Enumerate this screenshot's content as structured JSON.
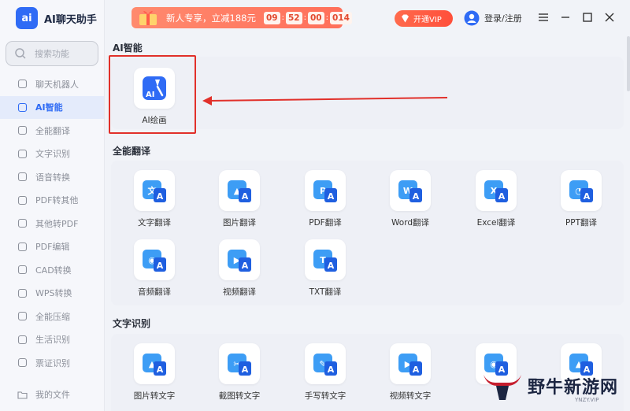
{
  "app": {
    "logo_text": "ai",
    "title": "AI聊天助手"
  },
  "search": {
    "placeholder": "搜索功能"
  },
  "sidebar": {
    "items": [
      {
        "label": "聊天机器人",
        "icon": "robot-icon",
        "active": false
      },
      {
        "label": "AI智能",
        "icon": "ai-list-icon",
        "active": true
      },
      {
        "label": "全能翻译",
        "icon": "translate-icon",
        "active": false
      },
      {
        "label": "文字识别",
        "icon": "ocr-icon",
        "active": false
      },
      {
        "label": "语音转换",
        "icon": "voice-icon",
        "active": false
      },
      {
        "label": "PDF转其他",
        "icon": "pdf-convert-icon",
        "active": false
      },
      {
        "label": "其他转PDF",
        "icon": "to-pdf-icon",
        "active": false
      },
      {
        "label": "PDF编辑",
        "icon": "pdf-edit-icon",
        "active": false
      },
      {
        "label": "CAD转换",
        "icon": "cad-icon",
        "active": false
      },
      {
        "label": "WPS转换",
        "icon": "wps-icon",
        "active": false
      },
      {
        "label": "全能压缩",
        "icon": "compress-icon",
        "active": false
      },
      {
        "label": "生活识别",
        "icon": "life-scan-icon",
        "active": false
      },
      {
        "label": "票证识别",
        "icon": "ticket-icon",
        "active": false
      }
    ],
    "bottom": {
      "label": "我的文件",
      "icon": "folder-icon"
    }
  },
  "promo": {
    "text": "新人专享，立减188元",
    "timer": [
      "09",
      "52",
      "00",
      "014"
    ]
  },
  "header": {
    "vip_label": "开通VIP",
    "login_label": "登录/注册"
  },
  "sections": {
    "ai": {
      "title": "AI智能",
      "tools": [
        {
          "label": "AI绘画",
          "icon": "ai-paint-icon"
        }
      ]
    },
    "translate": {
      "title": "全能翻译",
      "tools": [
        {
          "label": "文字翻译",
          "icon": "text-translate-icon",
          "glyph": "文"
        },
        {
          "label": "图片翻译",
          "icon": "image-translate-icon",
          "glyph": "▲"
        },
        {
          "label": "PDF翻译",
          "icon": "pdf-translate-icon",
          "glyph": "P"
        },
        {
          "label": "Word翻译",
          "icon": "word-translate-icon",
          "glyph": "W"
        },
        {
          "label": "Excel翻译",
          "icon": "excel-translate-icon",
          "glyph": "X"
        },
        {
          "label": "PPT翻译",
          "icon": "ppt-translate-icon",
          "glyph": "◔"
        },
        {
          "label": "音频翻译",
          "icon": "audio-translate-icon",
          "glyph": "◉"
        },
        {
          "label": "视频翻译",
          "icon": "video-translate-icon",
          "glyph": "▶"
        },
        {
          "label": "TXT翻译",
          "icon": "txt-translate-icon",
          "glyph": "T"
        }
      ]
    },
    "ocr": {
      "title": "文字识别",
      "tools": [
        {
          "label": "图片转文字",
          "icon": "image-to-text-icon",
          "glyph": "▲"
        },
        {
          "label": "截图转文字",
          "icon": "screenshot-to-text-icon",
          "glyph": "✂"
        },
        {
          "label": "手写转文字",
          "icon": "handwriting-to-text-icon",
          "glyph": "✎"
        },
        {
          "label": "视频转文字",
          "icon": "video-to-text-icon",
          "glyph": "▶"
        },
        {
          "label": "",
          "icon": "audio-to-text-icon",
          "glyph": "◉"
        },
        {
          "label": "",
          "icon": "image-to-text-2-icon",
          "glyph": "▲"
        }
      ]
    }
  },
  "watermark": {
    "text": "野牛新游网",
    "sub": "YNZY.VIP"
  },
  "colors": {
    "accent": "#2f6bf5",
    "highlight": "#e1302a",
    "promo": "#ff7a62"
  }
}
